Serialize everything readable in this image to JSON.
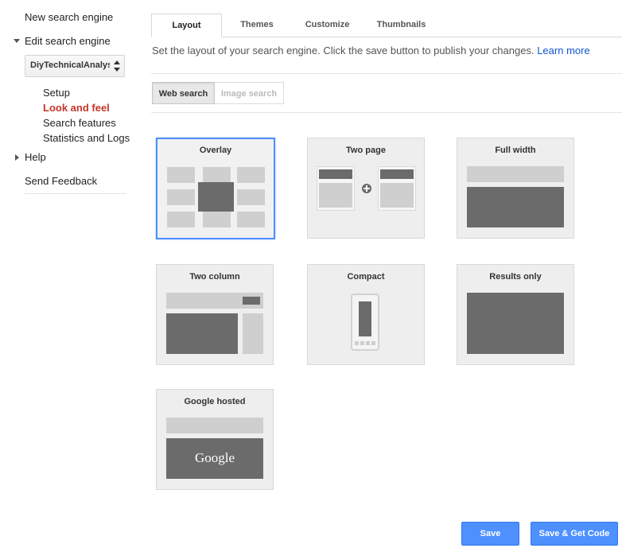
{
  "sidebar": {
    "new_engine": "New search engine",
    "edit_engine": "Edit search engine",
    "engine_select_value": "DiyTechnicalAnalysis",
    "sub_items": [
      "Setup",
      "Look and feel",
      "Search features",
      "Statistics and Logs"
    ],
    "active_sub_item": "Look and feel",
    "help": "Help",
    "feedback": "Send Feedback"
  },
  "tabs": [
    {
      "label": "Layout",
      "active": true
    },
    {
      "label": "Themes",
      "active": false
    },
    {
      "label": "Customize",
      "active": false
    },
    {
      "label": "Thumbnails",
      "active": false
    }
  ],
  "description": {
    "text": "Set the layout of your search engine. Click the save button to publish your changes.",
    "link": "Learn more"
  },
  "search_type": {
    "web": "Web search",
    "image": "Image search",
    "selected": "Web search"
  },
  "layouts": [
    {
      "title": "Overlay",
      "selected": true
    },
    {
      "title": "Two page",
      "selected": false
    },
    {
      "title": "Full width",
      "selected": false
    },
    {
      "title": "Two column",
      "selected": false
    },
    {
      "title": "Compact",
      "selected": false
    },
    {
      "title": "Results only",
      "selected": false
    },
    {
      "title": "Google hosted",
      "selected": false
    }
  ],
  "google_logo_text": "Google",
  "buttons": {
    "save": "Save",
    "save_get_code": "Save & Get Code"
  },
  "colors": {
    "accent_blue": "#4d90fe",
    "active_red": "#c6352a",
    "link_blue": "#1155cc"
  }
}
